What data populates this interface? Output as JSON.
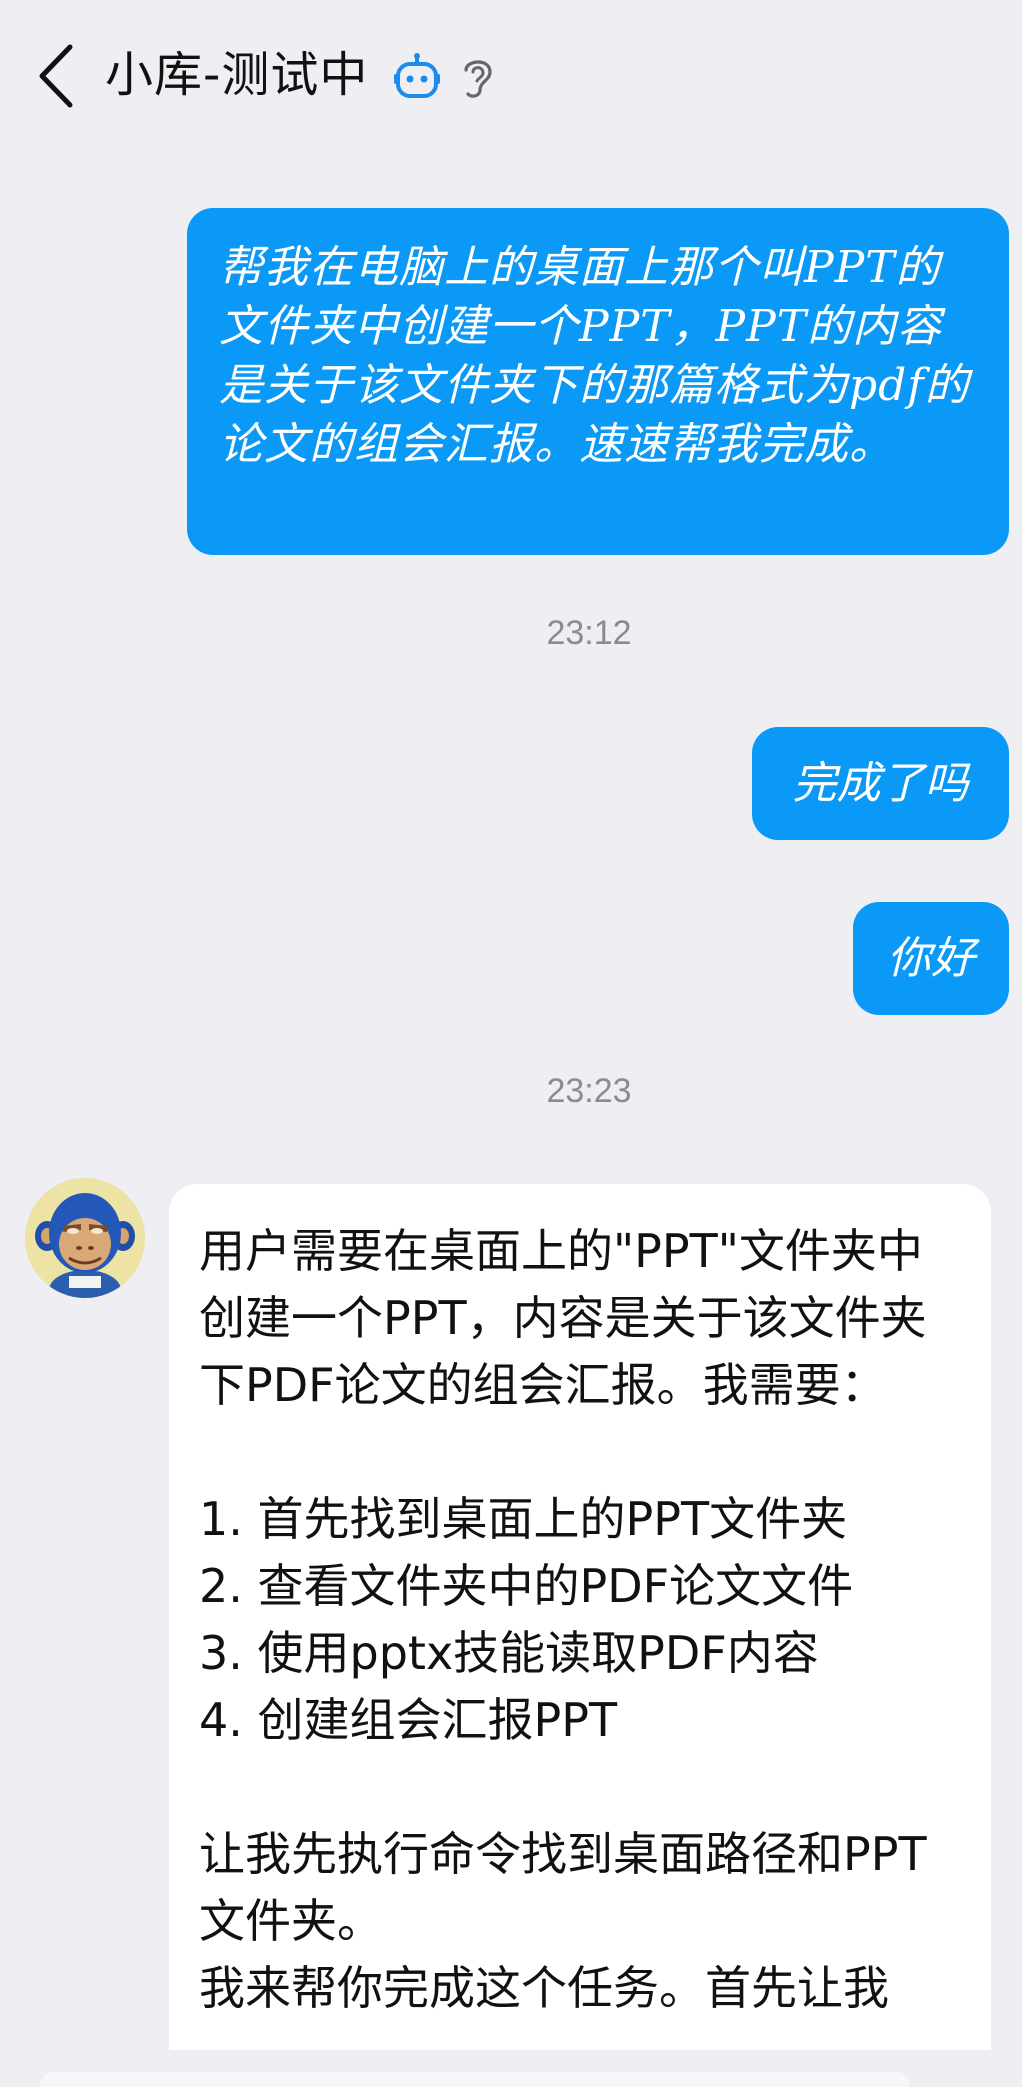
{
  "header": {
    "title": "小库-测试中",
    "back_icon": "chevron-left-icon",
    "bot_icon": "robot-icon",
    "ear_icon": "ear-icon",
    "accent": "#1a8cf0"
  },
  "messages": {
    "user_1": "帮我在电脑上的桌面上那个叫PPT的文件夹中创建一个PPT，PPT的内容是关于该文件夹下的那篇格式为pdf的论文的组会汇报。速速帮我完成。",
    "time_1": "23:12",
    "user_2": "完成了吗",
    "user_3": "你好",
    "time_2": "23:23",
    "bot_1": {
      "intro": "用户需要在桌面上的\"PPT\"文件夹中创建一个PPT，内容是关于该文件夹下PDF论文的组会汇报。我需要：",
      "steps": [
        "1. 首先找到桌面上的PPT文件夹",
        "2. 查看文件夹中的PDF论文文件",
        "3. 使用pptx技能读取PDF内容",
        "4. 创建组会汇报PPT"
      ],
      "outro": "让我先执行命令找到桌面路径和PPT文件夹。",
      "cut_line": "我来帮你完成这个任务。首先让我"
    }
  },
  "colors": {
    "user_bubble": "#0a99f7",
    "background": "#eeeef3",
    "bot_bubble": "#ffffff"
  }
}
